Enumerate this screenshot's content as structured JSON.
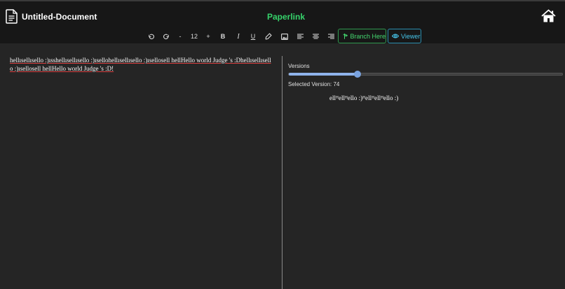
{
  "header": {
    "doc_title": "Untitled-Document",
    "brand": "Paperlink",
    "doc_icon": "document-icon",
    "home_icon": "home-icon"
  },
  "toolbar": {
    "font_decrease": "-",
    "font_size": "12",
    "font_increase": "+",
    "bold": "B",
    "italic": "I",
    "underline": "U",
    "branch_label": "Branch Here",
    "viewer_label": "Viewer",
    "icons": [
      "undo-icon",
      "redo-icon",
      "highlighter-icon",
      "image-icon",
      "align-left-icon",
      "align-center-icon",
      "align-right-icon",
      "branch-icon",
      "eye-icon"
    ]
  },
  "editor": {
    "text": "hellısellısello :)ısshellısellısello :)ısellohellısellısello :)ısellosell hellHello world Judge 's :Dhellısellısell o :)ısellosell hellHello world Judge 's :D!"
  },
  "versions": {
    "label": "Versions",
    "selected_label": "Selected Version: 74",
    "slider_fraction": 0.25,
    "preview_text": "ellᴴellᴴello :)ᴴellᴴellᴴello :)"
  },
  "colors": {
    "brand": "#36d36b",
    "branch_button": "#45d870",
    "viewer_button": "#46c5ea",
    "slider": "#8fb4ec"
  }
}
